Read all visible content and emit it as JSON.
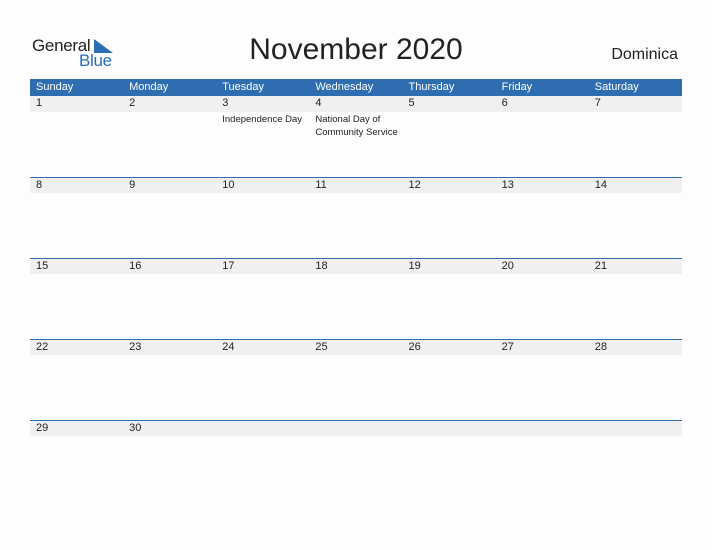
{
  "logo": {
    "word1": "General",
    "word2": "Blue"
  },
  "header": {
    "title": "November 2020",
    "country": "Dominica"
  },
  "colors": {
    "accent": "#2e6db0",
    "date_bar": "#f0f0f0"
  },
  "weekdays": [
    "Sunday",
    "Monday",
    "Tuesday",
    "Wednesday",
    "Thursday",
    "Friday",
    "Saturday"
  ],
  "weeks": [
    {
      "dates": [
        "1",
        "2",
        "3",
        "4",
        "5",
        "6",
        "7"
      ],
      "events": [
        "",
        "",
        "Independence Day",
        "National Day of Community Service",
        "",
        "",
        ""
      ]
    },
    {
      "dates": [
        "8",
        "9",
        "10",
        "11",
        "12",
        "13",
        "14"
      ],
      "events": [
        "",
        "",
        "",
        "",
        "",
        "",
        ""
      ]
    },
    {
      "dates": [
        "15",
        "16",
        "17",
        "18",
        "19",
        "20",
        "21"
      ],
      "events": [
        "",
        "",
        "",
        "",
        "",
        "",
        ""
      ]
    },
    {
      "dates": [
        "22",
        "23",
        "24",
        "25",
        "26",
        "27",
        "28"
      ],
      "events": [
        "",
        "",
        "",
        "",
        "",
        "",
        ""
      ]
    },
    {
      "dates": [
        "29",
        "30",
        "",
        "",
        "",
        "",
        ""
      ],
      "events": [
        "",
        "",
        "",
        "",
        "",
        "",
        ""
      ]
    }
  ]
}
